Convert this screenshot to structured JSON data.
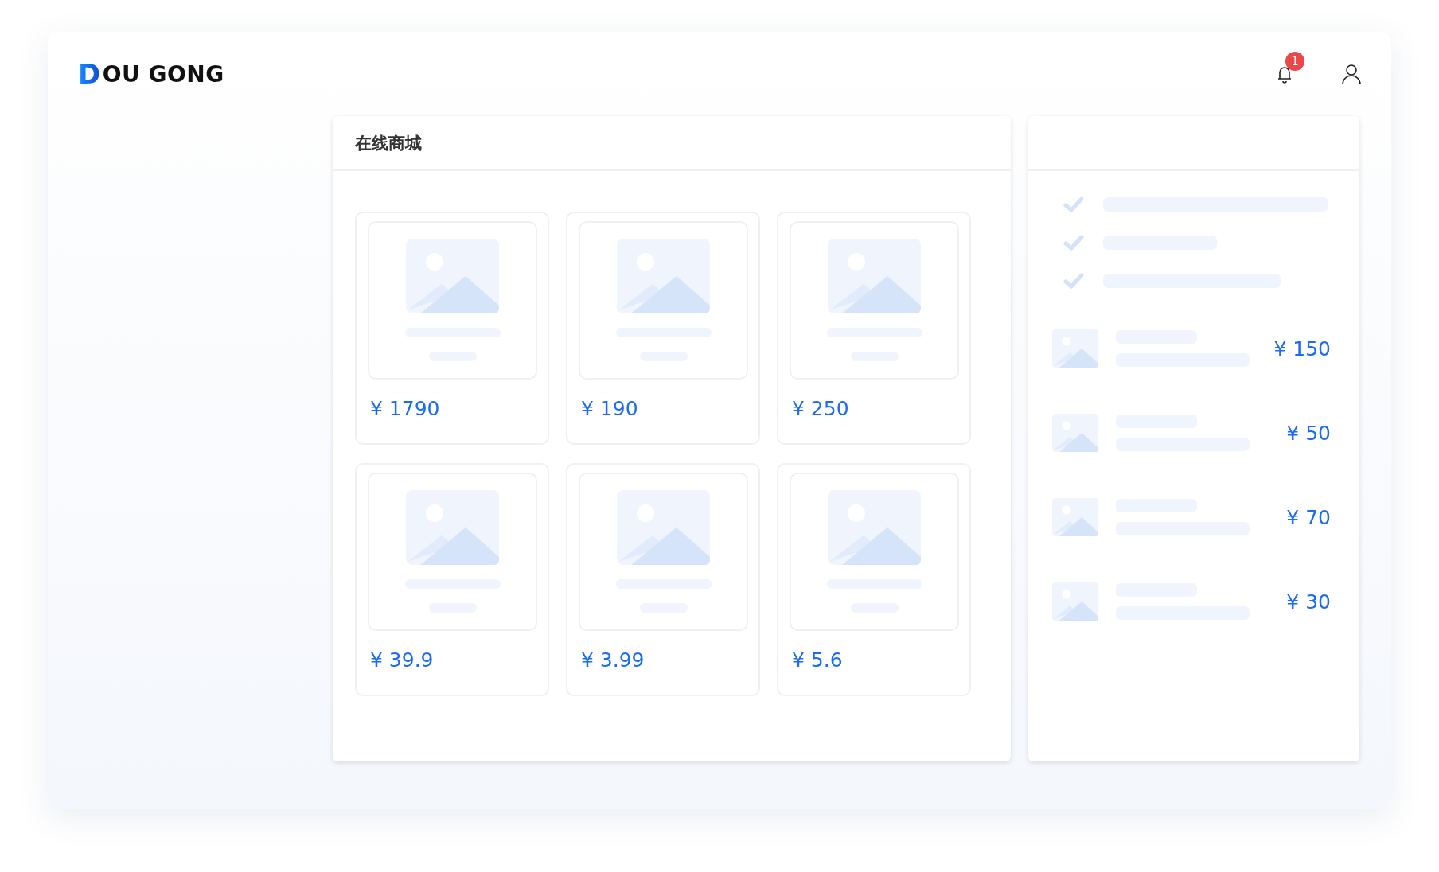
{
  "header": {
    "logo": {
      "mark": "D",
      "text": "OU GONG"
    },
    "notifications": {
      "badge": "1"
    }
  },
  "shop": {
    "title": "在线商城",
    "products": [
      {
        "price": "¥ 1790"
      },
      {
        "price": "¥ 190"
      },
      {
        "price": "¥ 250"
      },
      {
        "price": "¥ 39.9"
      },
      {
        "price": "¥ 3.99"
      },
      {
        "price": "¥ 5.6"
      }
    ]
  },
  "side_panel": {
    "items": [
      {
        "price": "¥ 150"
      },
      {
        "price": "¥ 50"
      },
      {
        "price": "¥ 70"
      },
      {
        "price": "¥ 30"
      }
    ]
  }
}
